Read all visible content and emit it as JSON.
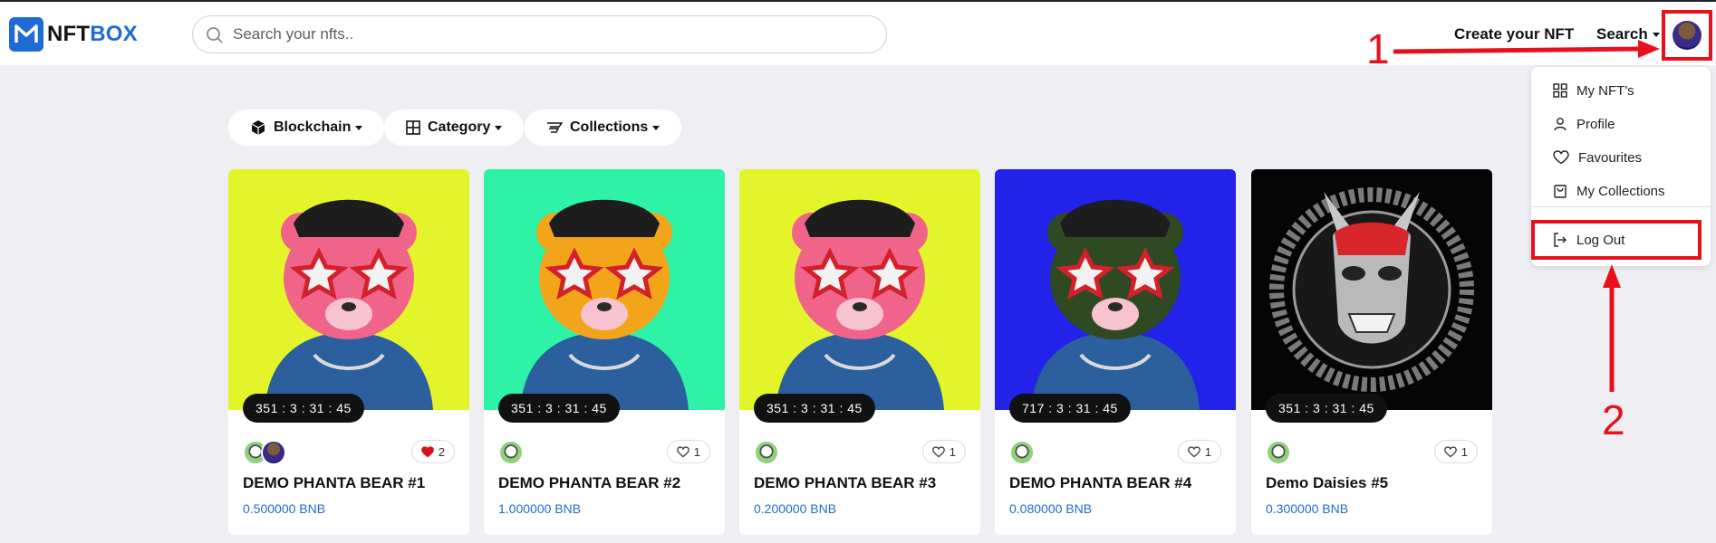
{
  "header": {
    "logo_prefix": "NFT",
    "logo_suffix": "BOX",
    "search_placeholder": "Search your nfts..",
    "create_label": "Create your NFT",
    "search_label": "Search"
  },
  "filters": [
    {
      "label": "Blockchain",
      "icon": "cube-icon"
    },
    {
      "label": "Category",
      "icon": "grid-icon"
    },
    {
      "label": "Collections",
      "icon": "collection-icon"
    }
  ],
  "menu": {
    "items": [
      {
        "label": "My NFT's",
        "icon": "grid-icon"
      },
      {
        "label": "Profile",
        "icon": "user-icon"
      },
      {
        "label": "Favourites",
        "icon": "heart-icon"
      },
      {
        "label": "My Collections",
        "icon": "bag-icon"
      },
      {
        "label": "Log Out",
        "icon": "logout-icon"
      }
    ]
  },
  "annotations": {
    "first": "1",
    "second": "2",
    "color": "#e8111b"
  },
  "cards": [
    {
      "name": "DEMO PHANTA BEAR #1",
      "price": "0.500000 BNB",
      "timer": "351 : 3 : 31 : 45",
      "likes": "2",
      "liked": true,
      "bg": "#e3f52a",
      "bear": "#f0648a"
    },
    {
      "name": "DEMO PHANTA BEAR #2",
      "price": "1.000000 BNB",
      "timer": "351 : 3 : 31 : 45",
      "likes": "1",
      "liked": false,
      "bg": "#2ef2a5",
      "bear": "#f2a51a"
    },
    {
      "name": "DEMO PHANTA BEAR #3",
      "price": "0.200000 BNB",
      "timer": "351 : 3 : 31 : 45",
      "likes": "1",
      "liked": false,
      "bg": "#e3f52a",
      "bear": "#f0648a"
    },
    {
      "name": "DEMO PHANTA BEAR #4",
      "price": "0.080000 BNB",
      "timer": "717 : 3 : 31 : 45",
      "likes": "1",
      "liked": false,
      "bg": "#2222e8",
      "bear": "#2f4a22"
    },
    {
      "name": "Demo Daisies #5",
      "price": "0.300000 BNB",
      "timer": "351 : 3 : 31 : 45",
      "likes": "1",
      "liked": false,
      "bg": "#050505",
      "bear": "#b9b9b9"
    }
  ]
}
